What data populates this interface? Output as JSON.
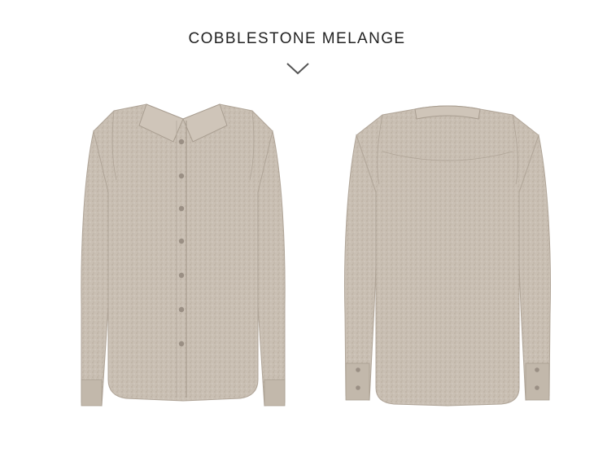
{
  "header": {
    "title": "COBBLESTONE MELANGE"
  },
  "icons": {
    "expand": "chevron-down-icon"
  },
  "colors": {
    "fabric": "#c9bfb3",
    "fabric_shadow": "#a99e91",
    "button": "#9a8f84",
    "title_text": "#222222"
  },
  "images": [
    {
      "name": "shirt-front-image",
      "view": "front"
    },
    {
      "name": "shirt-back-image",
      "view": "back"
    }
  ]
}
